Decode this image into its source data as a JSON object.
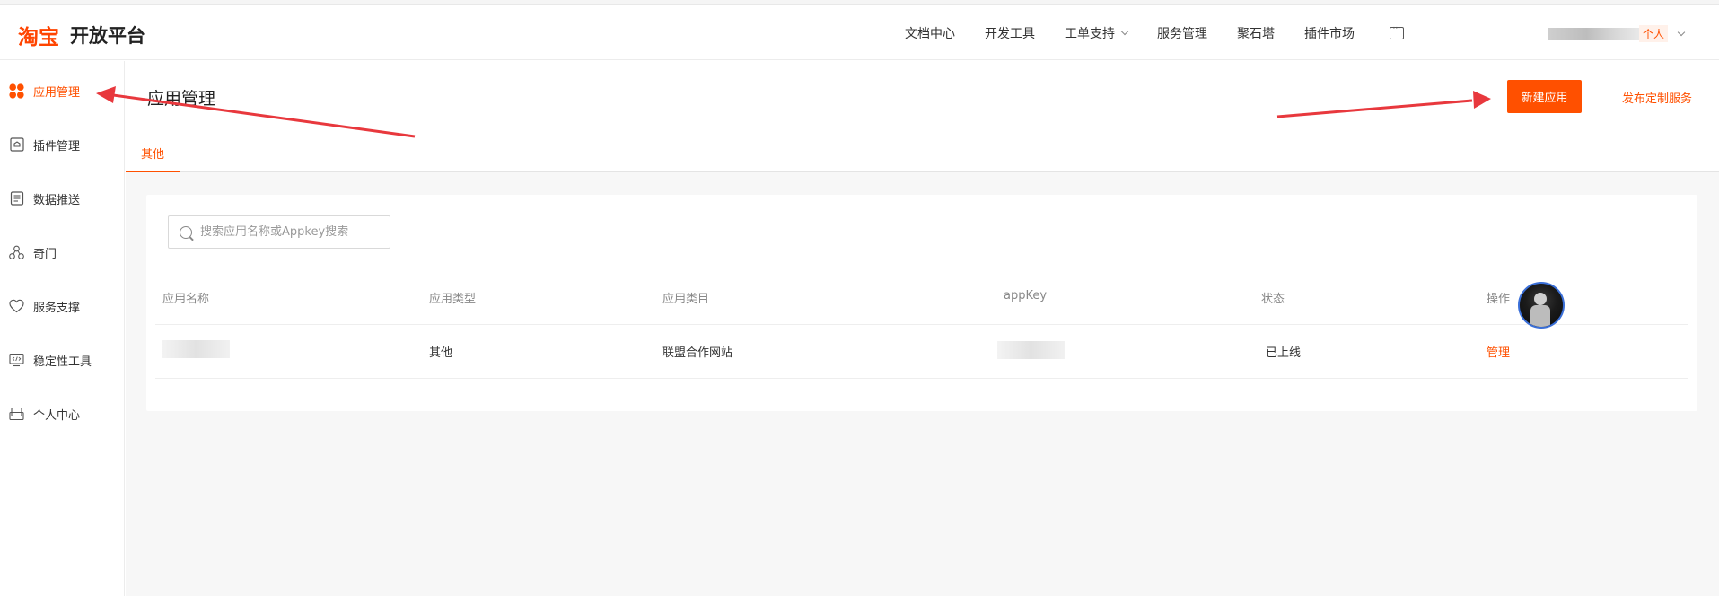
{
  "header": {
    "logo_mark": "淘宝",
    "logo_text": "开放平台",
    "nav": [
      {
        "label": "文档中心"
      },
      {
        "label": "开发工具"
      },
      {
        "label": "工单支持"
      },
      {
        "label": "服务管理"
      },
      {
        "label": "聚石塔"
      },
      {
        "label": "插件市场"
      }
    ],
    "user_badge": "个人"
  },
  "sidebar": {
    "items": [
      {
        "label": "应用管理",
        "icon": "apps-icon",
        "active": true
      },
      {
        "label": "插件管理",
        "icon": "plugin-icon"
      },
      {
        "label": "数据推送",
        "icon": "data-push-icon"
      },
      {
        "label": "奇门",
        "icon": "qimen-icon"
      },
      {
        "label": "服务支撑",
        "icon": "heart-icon"
      },
      {
        "label": "稳定性工具",
        "icon": "code-monitor-icon"
      },
      {
        "label": "个人中心",
        "icon": "personal-center-icon"
      }
    ]
  },
  "main": {
    "page_title": "应用管理",
    "new_app_button": "新建应用",
    "publish_link": "发布定制服务",
    "tabs": [
      {
        "label": "其他"
      }
    ],
    "search": {
      "placeholder": "搜索应用名称或Appkey搜索",
      "value": ""
    },
    "table": {
      "columns": [
        "应用名称",
        "应用类型",
        "应用类目",
        "appKey",
        "状态",
        "操作"
      ],
      "rows": [
        {
          "name": "",
          "type": "其他",
          "category": "联盟合作网站",
          "appkey": "",
          "status": "已上线",
          "action": "管理"
        }
      ]
    }
  },
  "colors": {
    "accent": "#ff5000",
    "annotation_arrow": "#e8383d"
  }
}
